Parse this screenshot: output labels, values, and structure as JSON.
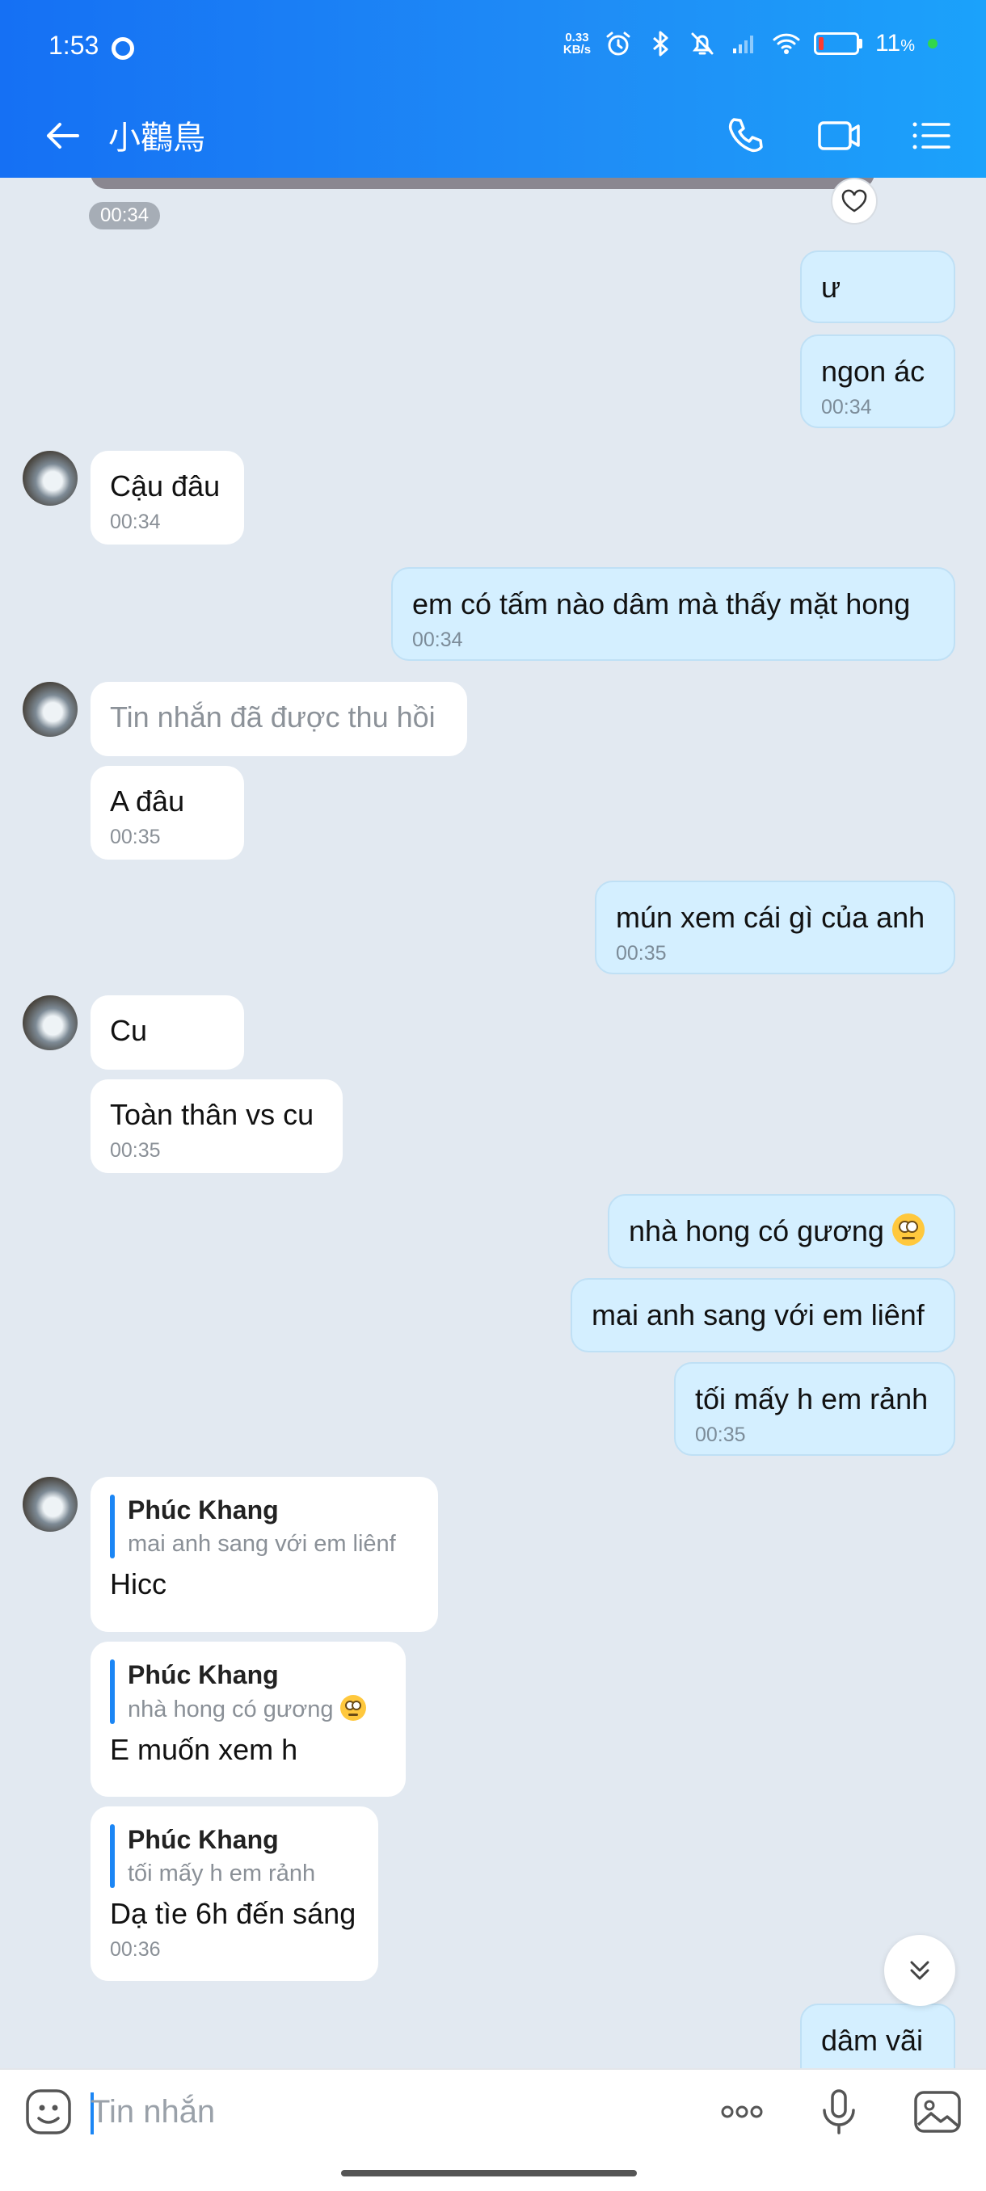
{
  "status_bar": {
    "time": "1:53",
    "net_speed_value": "0.33",
    "net_speed_unit": "KB/s",
    "battery": "11",
    "battery_unit": "%"
  },
  "header": {
    "title": "小鸛鳥"
  },
  "top_fragment": {
    "time": "00:34"
  },
  "messages": [
    {
      "text": "ư"
    },
    {
      "text": "ngon ác",
      "time": "00:34"
    },
    {
      "text": "Cậu đâu",
      "time": "00:34"
    },
    {
      "text": "em có tấm nào dâm mà thấy mặt hong",
      "time": "00:34"
    },
    {
      "text": "Tin nhắn đã được thu hồi"
    },
    {
      "text": "A đâu",
      "time": "00:35"
    },
    {
      "text": "mún xem cái gì của anh",
      "time": "00:35"
    },
    {
      "text": "Cu"
    },
    {
      "text": "Toàn thân vs cu",
      "time": "00:35"
    },
    {
      "text": "nhà hong có gương"
    },
    {
      "text": "mai anh sang với em liênf"
    },
    {
      "text": "tối mấy h em rảnh",
      "time": "00:35"
    },
    {
      "quote_name": "Phúc Khang",
      "quote_text": "mai anh sang với em liênf",
      "text": "Hicc"
    },
    {
      "quote_name": "Phúc Khang",
      "quote_text": "nhà hong có gương",
      "text": "E muốn xem h"
    },
    {
      "quote_name": "Phúc Khang",
      "quote_text": "tối mấy h em rảnh",
      "text": "Dạ tìe 6h đến sáng",
      "time": "00:36"
    },
    {
      "text": "dâm vãi"
    }
  ],
  "input": {
    "placeholder": "Tin nhắn"
  },
  "icons": {
    "back": "arrow-left-icon",
    "call": "phone-icon",
    "video": "video-camera-icon",
    "menu": "list-menu-icon",
    "heart": "heart-icon",
    "scroll": "chevron-double-down-icon",
    "sticker": "sticker-face-icon",
    "more": "more-dots-icon",
    "mic": "microphone-icon",
    "gallery": "image-icon"
  },
  "colors": {
    "header_start": "#1570f4",
    "header_end": "#1ba2fb",
    "chat_background": "#e2e9f1",
    "outgoing_bubble": "#d4efff",
    "incoming_bubble": "#ffffff",
    "accent": "#1b86f5"
  }
}
